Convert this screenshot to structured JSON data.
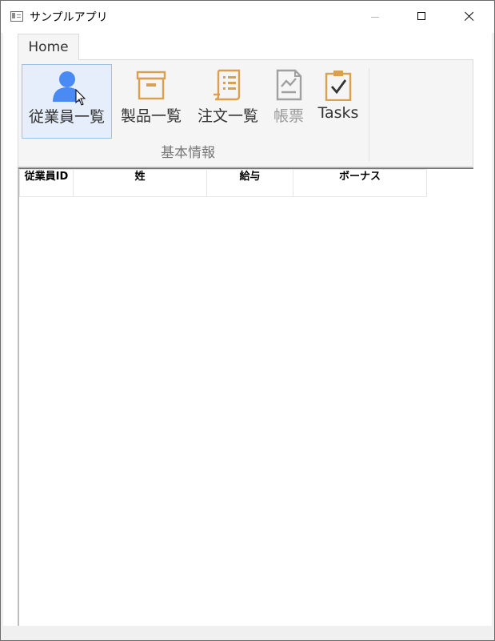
{
  "window": {
    "title": "サンプルアプリ"
  },
  "ribbon": {
    "tab": "Home",
    "group_label": "基本情報",
    "buttons": [
      {
        "label": "従業員一覧",
        "icon": "person-icon",
        "color": "#4a8af4",
        "state": "selected"
      },
      {
        "label": "製品一覧",
        "icon": "archive-box-icon",
        "color": "#d9a050"
      },
      {
        "label": "注文一覧",
        "icon": "document-list-icon",
        "color": "#d9a050"
      },
      {
        "label": "帳票",
        "icon": "report-chart-icon",
        "color": "#a0a0a0",
        "state": "disabled"
      },
      {
        "label": "Tasks",
        "icon": "clipboard-check-icon",
        "color": "#d9a050"
      }
    ]
  },
  "grid": {
    "columns": [
      "従業員ID",
      "姓",
      "給与",
      "ボーナス"
    ],
    "rows": []
  }
}
